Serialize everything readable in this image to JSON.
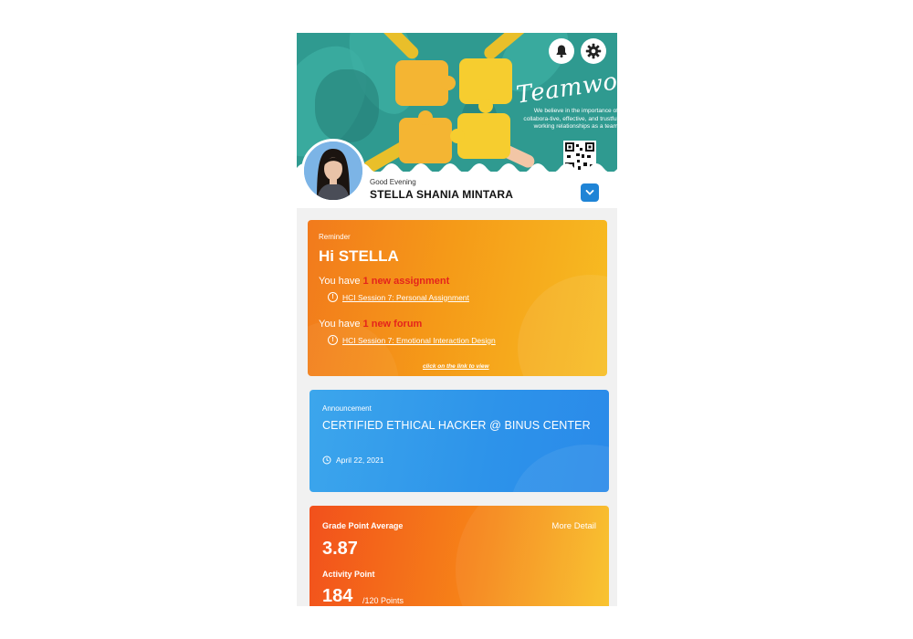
{
  "banner": {
    "headline": "Teamwork",
    "tagline": "We believe in the importance of collabora-tive, effective, and trustful working relationships as a team"
  },
  "header_icons": [
    "bell-icon",
    "gear-icon"
  ],
  "profile": {
    "greeting": "Good Evening",
    "name": "STELLA SHANIA MINTARA"
  },
  "reminder": {
    "label": "Reminder",
    "greeting": "Hi STELLA",
    "items": [
      {
        "prefix": "You have",
        "highlight": "1 new assignment",
        "link": "HCI Session 7: Personal Assignment"
      },
      {
        "prefix": "You have",
        "highlight": "1 new forum",
        "link": "HCI Session 7: Emotional Interaction Design"
      }
    ],
    "footer": "click on the link to view"
  },
  "announcement": {
    "label": "Announcement",
    "title": "CERTIFIED ETHICAL HACKER @ BINUS CENTER",
    "date": "April 22, 2021"
  },
  "gpa": {
    "label": "Grade Point Average",
    "more": "More Detail",
    "value": "3.87",
    "activity_label": "Activity Point",
    "activity_value": "184",
    "activity_unit": "/120 Points"
  },
  "colors": {
    "banner": "#2f9a90",
    "reminder_start": "#f27a1c",
    "reminder_end": "#f7bd22",
    "announcement": "#2d93ea",
    "gpa_start": "#f2501c",
    "gpa_end": "#f8c125",
    "highlight": "#e4241c",
    "accent": "#1f84d6"
  }
}
